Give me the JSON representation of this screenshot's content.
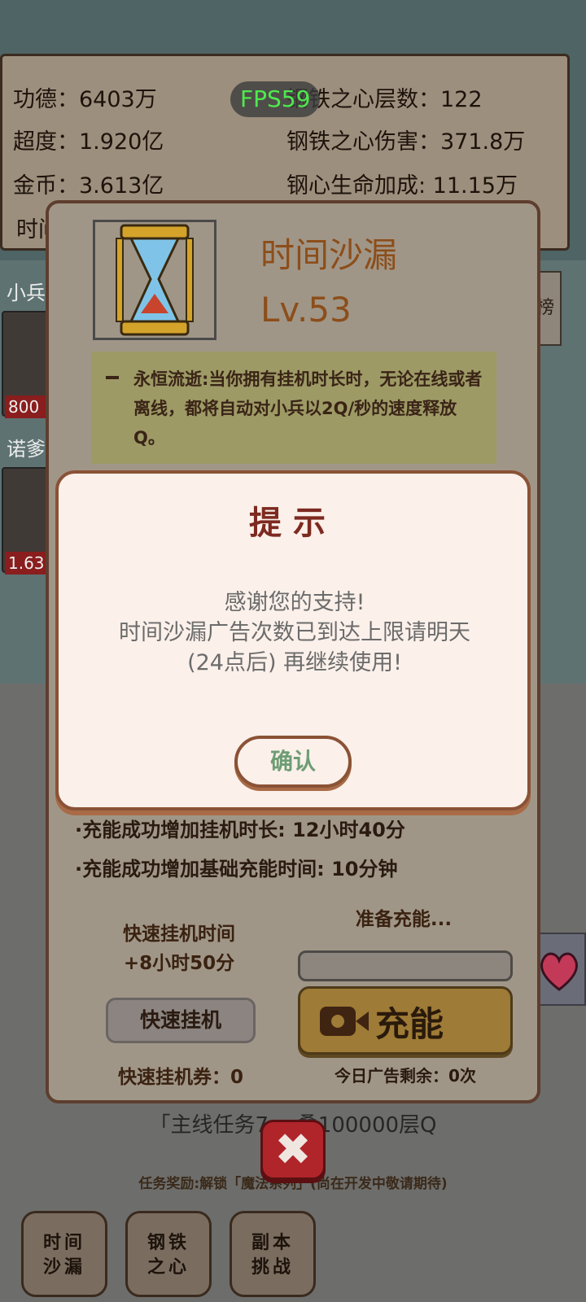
{
  "stats": {
    "merit": "功德：6403万",
    "transcend": "超度：1.920亿",
    "gold": "金币：3.613亿",
    "time_partial": "时间",
    "iron_layers": "钢铁之心层数：122",
    "iron_damage": "钢铁之心伤害：371.8万",
    "iron_hp_bonus": "钢心生命加成: 11.15万"
  },
  "fps": "FPS59",
  "lanes": [
    {
      "label": "小兵",
      "hp": "800"
    },
    {
      "label": "诺爹",
      "hp": "1.63"
    }
  ],
  "right_tab_label": "榜",
  "item": {
    "title": "时间沙漏",
    "level": "Lv.53",
    "desc_dash": "一",
    "description": "永恒流逝:当你拥有挂机时长时，无论在线或者离线，都将自动对小兵以2Q/秒的速度释放Q。",
    "charge_time_gain": "·充能成功增加挂机时长: 12小时40分",
    "charge_base_gain": "·充能成功增加基础充能时间: 10分钟",
    "quick_idle_title": "快速挂机时间",
    "quick_idle_gain": "+8小时50分",
    "preparing": "准备充能...",
    "charge_progress": 0,
    "quick_idle_button": "快速挂机",
    "charge_button": "充能",
    "quick_ticket": "快速挂机券：0",
    "ad_remaining": "今日广告剩余：0次",
    "close_icon": "close-x-icon"
  },
  "task": {
    "text": "「主线任务7」:叠100000层Q",
    "reward": "任务奖励:解锁「魔法系列」(尚在开发中敬请期待)"
  },
  "bottom_nav": [
    {
      "line1": "时间",
      "line2": "沙漏"
    },
    {
      "line1": "钢铁",
      "line2": "之心"
    },
    {
      "line1": "副本",
      "line2": "挑战"
    }
  ],
  "dialog": {
    "title": "提示",
    "line1": "感谢您的支持!",
    "line2": "时间沙漏广告次数已到达上限请明天",
    "line3": "(24点后) 再继续使用!",
    "confirm": "确认"
  },
  "colors": {
    "dialog_border": "#8a5236",
    "dialog_title": "#7d2a20",
    "confirm_text": "#6e9d74",
    "item_title": "#8c4e1a",
    "charge_button": "#9e7b36",
    "close_button": "#b0252a",
    "fps_text": "#4dea4d"
  }
}
